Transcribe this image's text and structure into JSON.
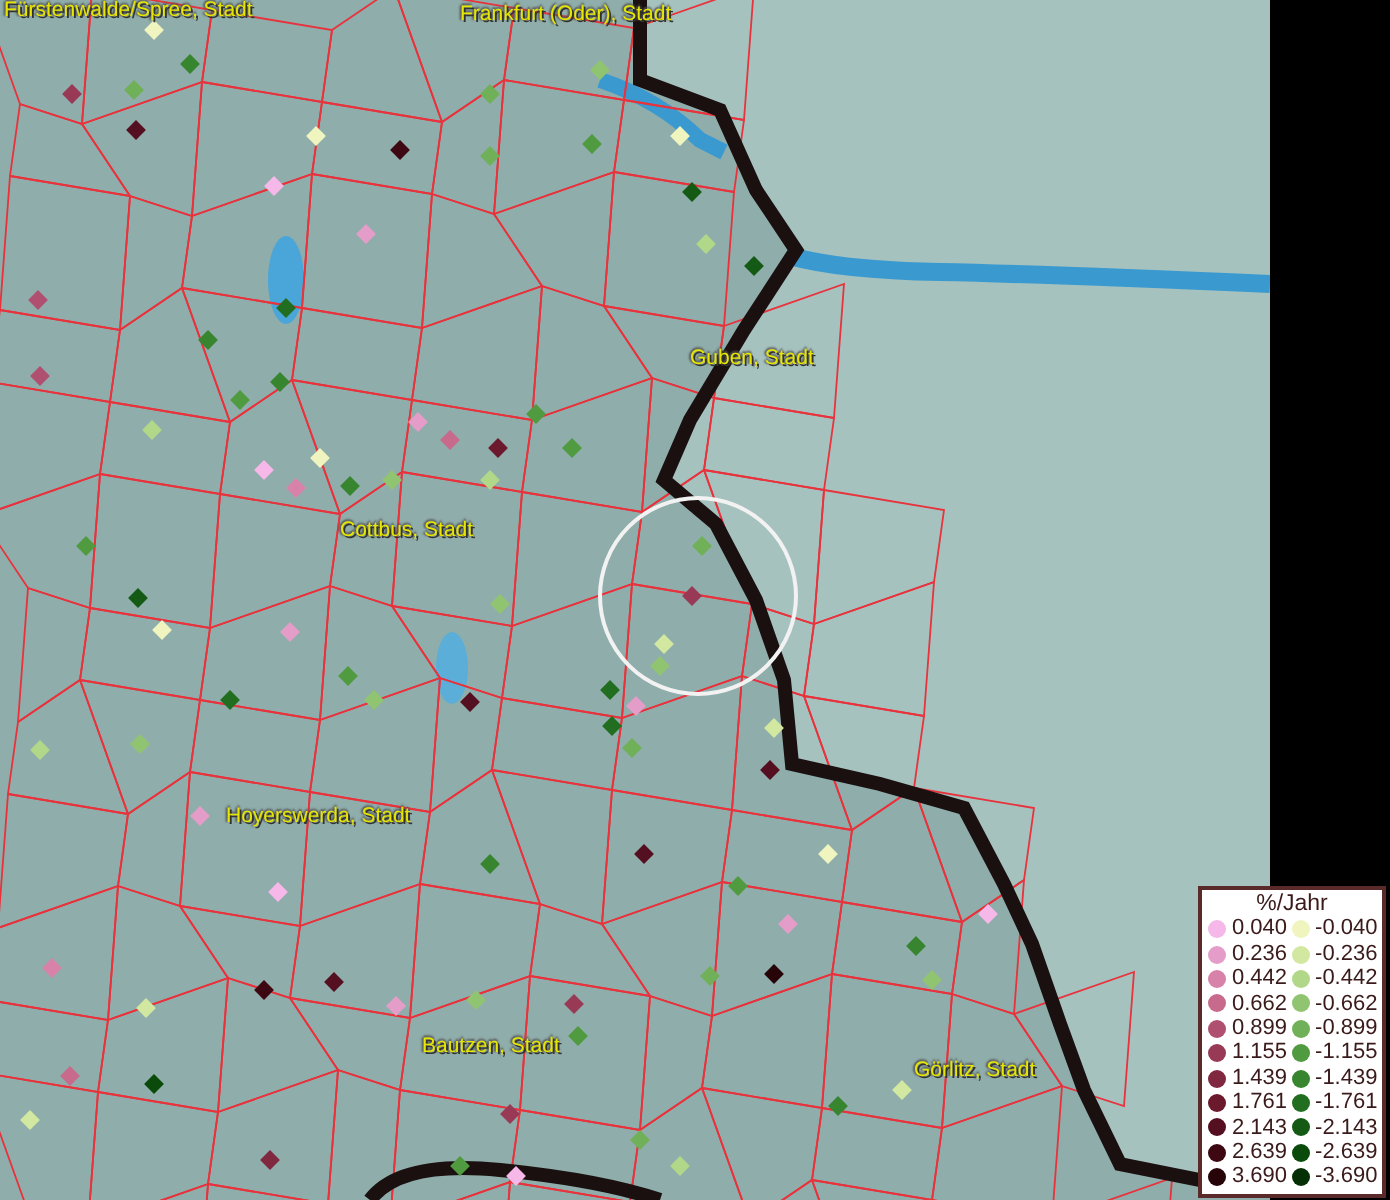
{
  "map": {
    "place_labels": [
      {
        "text": "Fürstenwalde/Spree, Stadt"
      },
      {
        "text": "Frankfurt (Oder), Stadt"
      },
      {
        "text": "Guben, Stadt"
      },
      {
        "text": "Cottbus, Stadt"
      },
      {
        "text": "Hoyerswerda, Stadt"
      },
      {
        "text": "Bautzen, Stadt"
      },
      {
        "text": "Görlitz, Stadt"
      }
    ]
  },
  "legend": {
    "title": "%/Jahr",
    "positive": [
      {
        "label": "0.040",
        "color": "#f5b8e8"
      },
      {
        "label": "0.236",
        "color": "#e49cc8"
      },
      {
        "label": "0.442",
        "color": "#d882aa"
      },
      {
        "label": "0.662",
        "color": "#c86a8c"
      },
      {
        "label": "0.899",
        "color": "#b05070"
      },
      {
        "label": "1.155",
        "color": "#983a55"
      },
      {
        "label": "1.439",
        "color": "#802840"
      },
      {
        "label": "1.761",
        "color": "#6a1a2c"
      },
      {
        "label": "2.143",
        "color": "#541020"
      },
      {
        "label": "2.639",
        "color": "#3e0812"
      },
      {
        "label": "3.690",
        "color": "#260408"
      }
    ],
    "negative": [
      {
        "label": "-0.040",
        "color": "#f0f5c0"
      },
      {
        "label": "-0.236",
        "color": "#d2e8a0"
      },
      {
        "label": "-0.442",
        "color": "#b0d888"
      },
      {
        "label": "-0.662",
        "color": "#90c470"
      },
      {
        "label": "-0.899",
        "color": "#70b058"
      },
      {
        "label": "-1.155",
        "color": "#509a40"
      },
      {
        "label": "-1.439",
        "color": "#388530"
      },
      {
        "label": "-1.761",
        "color": "#226e20"
      },
      {
        "label": "-2.143",
        "color": "#145a14"
      },
      {
        "label": "-2.639",
        "color": "#0a4a0a"
      },
      {
        "label": "-3.690",
        "color": "#053005"
      }
    ]
  }
}
